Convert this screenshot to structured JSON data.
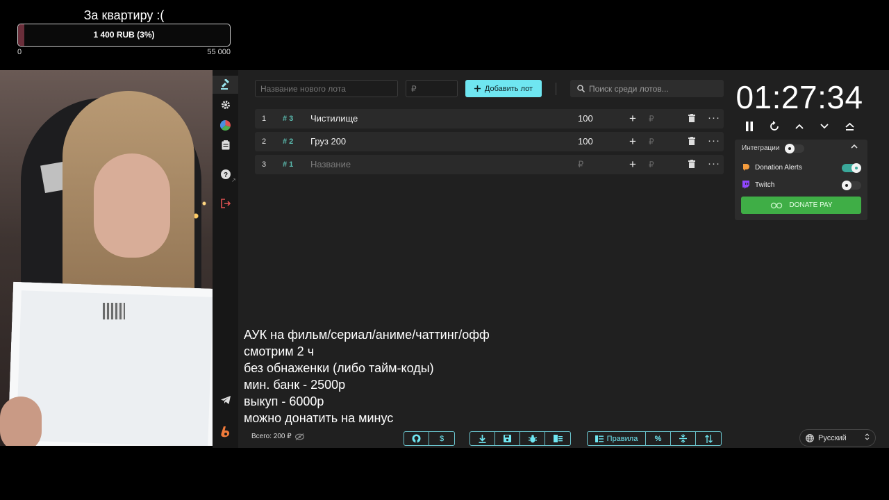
{
  "goal": {
    "title": "За квартиру :(",
    "label": "1 400 RUB (3%)",
    "progress_percent": 3,
    "min": "0",
    "max": "55 000",
    "fill_color": "#6a2e3a"
  },
  "sidebar": {
    "items": [
      {
        "icon": "gavel-icon",
        "active": true
      },
      {
        "icon": "gear-icon"
      },
      {
        "icon": "pie-chart-icon"
      },
      {
        "icon": "clipboard-icon"
      },
      {
        "icon": "help-icon"
      },
      {
        "icon": "logout-icon"
      },
      {
        "icon": "telegram-icon"
      },
      {
        "icon": "boosty-icon"
      }
    ]
  },
  "toolbar": {
    "lot_name_placeholder": "Название нового лота",
    "price_placeholder": "₽",
    "add_label": "Добавить лот",
    "search_placeholder": "Поиск среди лотов..."
  },
  "lots": [
    {
      "num": "1",
      "id": "# 3",
      "name": "Чистилище",
      "amount": "100",
      "currency": "₽"
    },
    {
      "num": "2",
      "id": "# 2",
      "name": "Груз 200",
      "amount": "100",
      "currency": "₽"
    },
    {
      "num": "3",
      "id": "# 1",
      "name": "Название",
      "amount": "₽",
      "currency": "₽"
    }
  ],
  "timer": {
    "value": "01:27:34"
  },
  "integrations": {
    "title": "Интеграции",
    "services": [
      {
        "name": "Donation Alerts",
        "enabled": true,
        "icon": "donationalerts-icon"
      },
      {
        "name": "Twitch",
        "enabled": false,
        "icon": "twitch-icon"
      }
    ],
    "donate_pay_label": "DONATE PAY"
  },
  "info_lines": [
    "АУК на фильм/сериал/аниме/чаттинг/офф",
    "смотрим 2 ч",
    "без обнаженки (либо тайм-коды)",
    "мин. банк - 2500р",
    "выкуп - 6000р",
    "можно донатить на минус"
  ],
  "footer": {
    "total": "Всего: 200 ₽",
    "rules_label": "Правила",
    "language": "Русский"
  },
  "colors": {
    "accent": "#6fe6f1",
    "teal": "#3aa89a",
    "donate_green": "#3fae46",
    "app_bg": "#202020"
  }
}
